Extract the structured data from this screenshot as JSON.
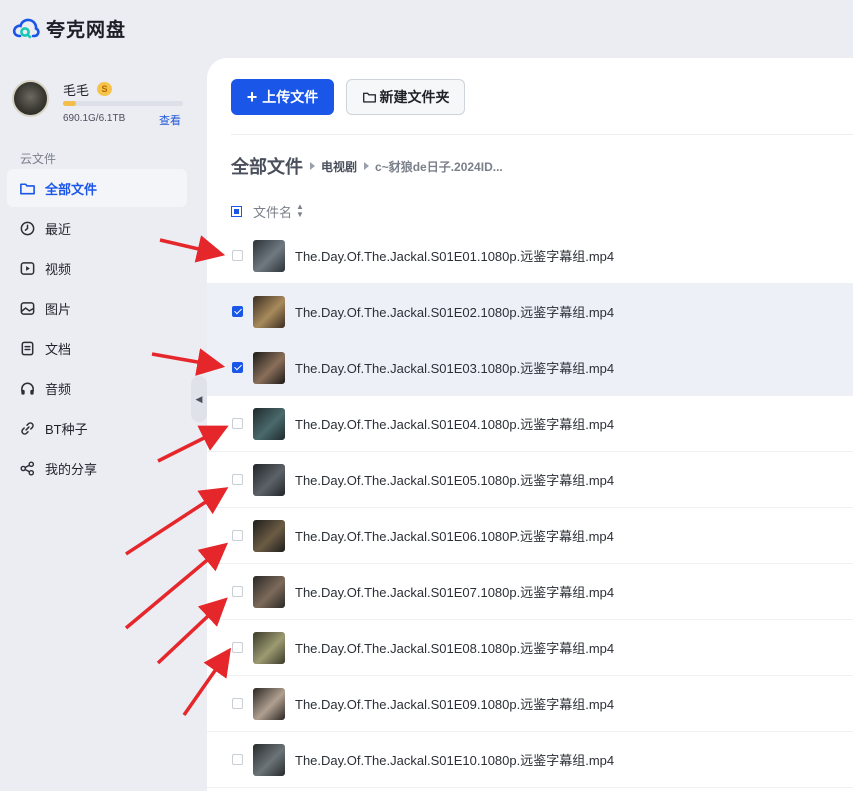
{
  "app": {
    "title": "夸克网盘",
    "logo_icon": "quark-cloud-logo"
  },
  "user": {
    "name": "毛毛",
    "vip_badge": "S",
    "storage_text": "690.1G/6.1TB",
    "storage_used_fraction": 0.11,
    "view_label": "查看"
  },
  "sidebar": {
    "section_label": "云文件",
    "items": [
      {
        "label": "全部文件",
        "icon": "folder-icon",
        "active": true
      },
      {
        "label": "最近",
        "icon": "clock-icon"
      },
      {
        "label": "视频",
        "icon": "video-icon"
      },
      {
        "label": "图片",
        "icon": "image-icon"
      },
      {
        "label": "文档",
        "icon": "document-icon"
      },
      {
        "label": "音频",
        "icon": "headphones-icon"
      },
      {
        "label": "BT种子",
        "icon": "link-icon"
      },
      {
        "label": "我的分享",
        "icon": "share-icon"
      }
    ]
  },
  "toolbar": {
    "upload_label": "上传文件",
    "new_folder_label": "新建文件夹"
  },
  "breadcrumb": {
    "root": "全部文件",
    "items": [
      "电视剧",
      "c~豺狼de日子.2024ID..."
    ]
  },
  "list": {
    "column_name": "文件名",
    "files": [
      {
        "name": "The.Day.Of.The.Jackal.S01E01.1080p.远鉴字幕组.mp4",
        "checked": false
      },
      {
        "name": "The.Day.Of.The.Jackal.S01E02.1080p.远鉴字幕组.mp4",
        "checked": true
      },
      {
        "name": "The.Day.Of.The.Jackal.S01E03.1080p.远鉴字幕组.mp4",
        "checked": true
      },
      {
        "name": "The.Day.Of.The.Jackal.S01E04.1080p.远鉴字幕组.mp4",
        "checked": false
      },
      {
        "name": "The.Day.Of.The.Jackal.S01E05.1080p.远鉴字幕组.mp4",
        "checked": false
      },
      {
        "name": "The.Day.Of.The.Jackal.S01E06.1080P.远鉴字幕组.mp4",
        "checked": false
      },
      {
        "name": "The.Day.Of.The.Jackal.S01E07.1080p.远鉴字幕组.mp4",
        "checked": false
      },
      {
        "name": "The.Day.Of.The.Jackal.S01E08.1080p.远鉴字幕组.mp4",
        "checked": false
      },
      {
        "name": "The.Day.Of.The.Jackal.S01E09.1080p.远鉴字幕组.mp4",
        "checked": false
      },
      {
        "name": "The.Day.Of.The.Jackal.S01E10.1080p.远鉴字幕组.mp4",
        "checked": false
      }
    ]
  },
  "colors": {
    "accent": "#1a56e8",
    "annotation_arrow": "#e5262a"
  }
}
